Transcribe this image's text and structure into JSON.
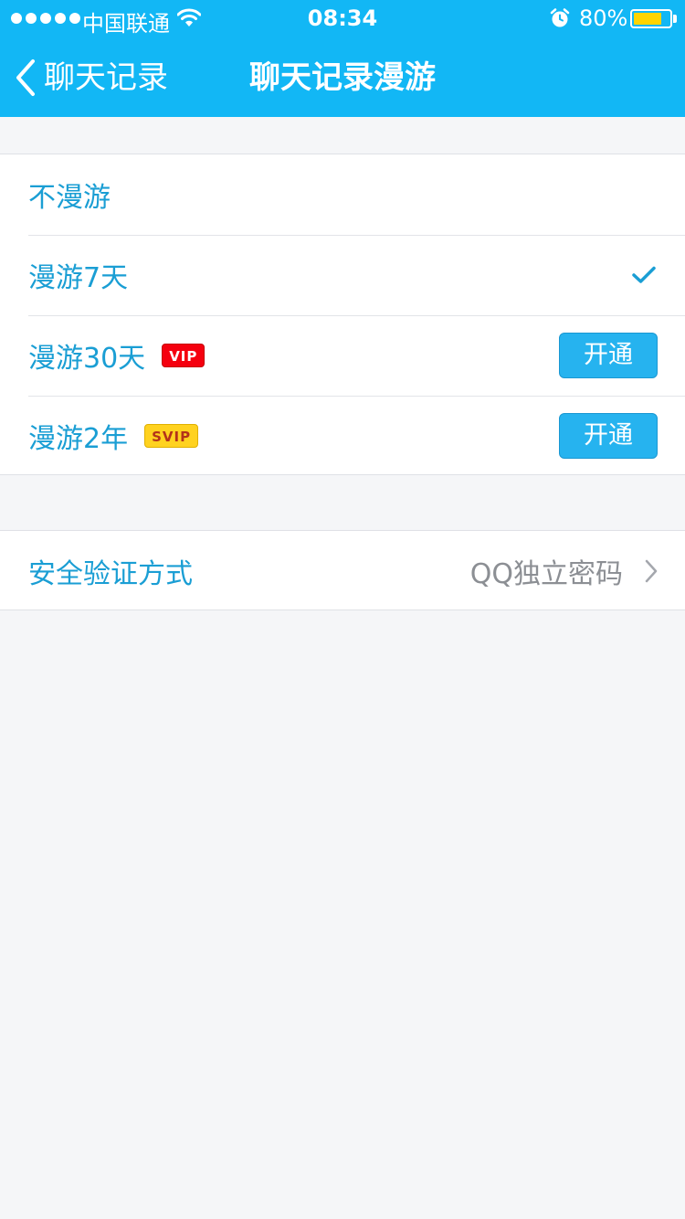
{
  "status_bar": {
    "carrier": "中国联通",
    "time": "08:34",
    "battery_percent": "80%",
    "battery_level": 0.8
  },
  "nav": {
    "back_label": "聊天记录",
    "title": "聊天记录漫游"
  },
  "roam_options": [
    {
      "label": "不漫游"
    },
    {
      "label": "漫游7天",
      "selected": true
    },
    {
      "label": "漫游30天",
      "badge": "VIP",
      "action": "开通"
    },
    {
      "label": "漫游2年",
      "badge": "SVIP",
      "action": "开通"
    }
  ],
  "security": {
    "label": "安全验证方式",
    "value": "QQ独立密码"
  },
  "colors": {
    "header": "#12b7f5",
    "accent_text": "#1a9ed4",
    "button": "#26b3ef",
    "vip_badge": "#f5000f",
    "svip_badge": "#ffd21f",
    "battery_fill": "#ffd400"
  }
}
